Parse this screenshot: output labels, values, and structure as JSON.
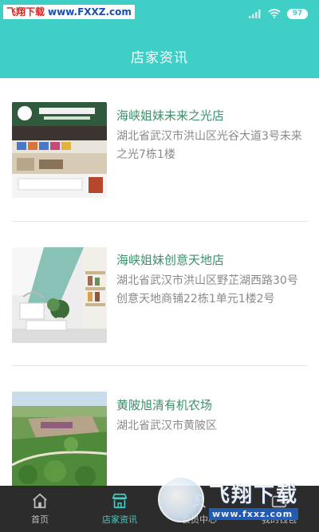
{
  "watermark": {
    "site": "飞翔下载",
    "url": "www.FXXZ.com"
  },
  "status": {
    "battery": "97"
  },
  "header": {
    "title": "店家资讯"
  },
  "stores": [
    {
      "name": "海峡姐妹未来之光店",
      "address": "湖北省武汉市洪山区光谷大道3号未来之光7栋1楼"
    },
    {
      "name": "海峡姐妹创意天地店",
      "address": "湖北省武汉市洪山区野芷湖西路30号创意天地商铺22栋1单元1楼2号"
    },
    {
      "name": "黄陂旭清有机农场",
      "address": "湖北省武汉市黄陂区"
    }
  ],
  "nav": [
    {
      "label": "首页",
      "icon": "home-icon"
    },
    {
      "label": "店家资讯",
      "icon": "store-icon"
    },
    {
      "label": "会员中心",
      "icon": "member-icon"
    },
    {
      "label": "我的钱包",
      "icon": "wallet-icon"
    }
  ],
  "logo_watermark": {
    "cn": "飞翔下载",
    "en": "www.fxxz.com"
  },
  "colors": {
    "accent": "#3fcfc6",
    "store_name": "#3c8f6a",
    "nav_bg": "#2c2c2c"
  }
}
